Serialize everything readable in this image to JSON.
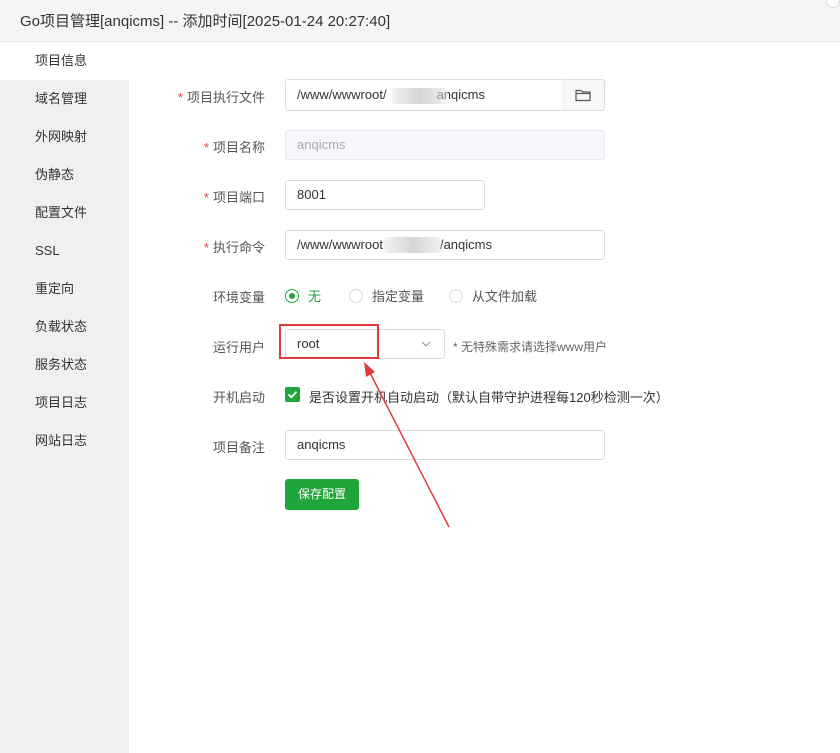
{
  "window": {
    "title": "Go项目管理[anqicms] -- 添加时间[2025-01-24 20:27:40]"
  },
  "sidebar": {
    "items": [
      {
        "label": "项目信息"
      },
      {
        "label": "域名管理"
      },
      {
        "label": "外网映射"
      },
      {
        "label": "伪静态"
      },
      {
        "label": "配置文件"
      },
      {
        "label": "SSL"
      },
      {
        "label": "重定向"
      },
      {
        "label": "负载状态"
      },
      {
        "label": "服务状态"
      },
      {
        "label": "项目日志"
      },
      {
        "label": "网站日志"
      }
    ],
    "active_index": 0
  },
  "form": {
    "exec_file": {
      "required_mark": "*",
      "label": "项目执行文件",
      "value_prefix": "/www/wwwroot/",
      "value_suffix": "anqicms",
      "folder_icon": "folder-icon"
    },
    "project_name": {
      "required_mark": "*",
      "label": "项目名称",
      "value": "anqicms"
    },
    "project_port": {
      "required_mark": "*",
      "label": "项目端口",
      "value": "8001"
    },
    "exec_command": {
      "required_mark": "*",
      "label": "执行命令",
      "value_prefix": "/www/wwwroot",
      "value_suffix": "/anqicms"
    },
    "env_vars": {
      "label": "环境变量",
      "options": [
        "无",
        "指定变量",
        "从文件加载"
      ],
      "selected": "无"
    },
    "run_user": {
      "label": "运行用户",
      "value": "root",
      "hint": "* 无特殊需求请选择www用户"
    },
    "autostart": {
      "label": "开机启动",
      "checked": true,
      "text": "是否设置开机自动启动（默认自带守护进程每120秒检测一次）"
    },
    "remark": {
      "label": "项目备注",
      "value": "anqicms"
    },
    "save_button": "保存配置"
  },
  "colors": {
    "accent": "#20a53a",
    "required": "#e84242",
    "annotation": "#e03c3c",
    "sidebar_bg": "#f0f0f0"
  }
}
